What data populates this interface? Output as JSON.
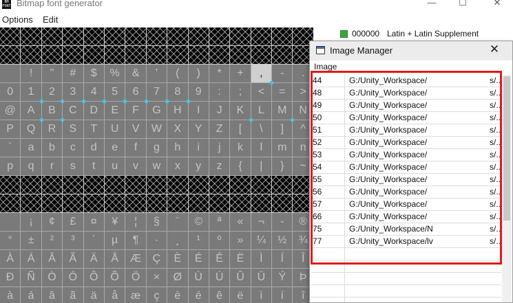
{
  "window": {
    "title": "Bitmap font generator",
    "icon_text": "BM FONT",
    "controls": {
      "minimize": "—",
      "maximize": "☐",
      "close": "✕"
    }
  },
  "menu": {
    "options": "Options",
    "edit": "Edit"
  },
  "grid": {
    "rows": [
      {
        "style": "black",
        "cells": [
          "",
          "",
          "",
          "",
          "",
          "",
          "",
          "",
          "",
          "",
          "",
          "",
          "",
          "",
          ""
        ]
      },
      {
        "style": "black",
        "cells": [
          "",
          "",
          "",
          "",
          "",
          "",
          "",
          "",
          "",
          "",
          "",
          "",
          "",
          "",
          ""
        ]
      },
      {
        "style": "gray",
        "cells": [
          " ",
          "!",
          "\"",
          "#",
          "$",
          "%",
          "&",
          "'",
          "(",
          ")",
          "*",
          "+",
          ",",
          "-",
          "."
        ]
      },
      {
        "style": "gray",
        "cells": [
          "0",
          "1",
          "2",
          "3",
          "4",
          "5",
          "6",
          "7",
          "8",
          "9",
          ":",
          ";",
          "<",
          "=",
          ">"
        ]
      },
      {
        "style": "gray",
        "cells": [
          "@",
          "A",
          "B",
          "C",
          "D",
          "E",
          "F",
          "G",
          "H",
          "I",
          "J",
          "K",
          "L",
          "M",
          "N"
        ]
      },
      {
        "style": "gray",
        "cells": [
          "P",
          "Q",
          "R",
          "S",
          "T",
          "U",
          "V",
          "W",
          "X",
          "Y",
          "Z",
          "[",
          "\\",
          "]",
          "^"
        ]
      },
      {
        "style": "gray",
        "cells": [
          "`",
          "a",
          "b",
          "c",
          "d",
          "e",
          "f",
          "g",
          "h",
          "i",
          "j",
          "k",
          "l",
          "m",
          "n"
        ]
      },
      {
        "style": "gray",
        "cells": [
          "p",
          "q",
          "r",
          "s",
          "t",
          "u",
          "v",
          "w",
          "x",
          "y",
          "z",
          "{",
          "|",
          "}",
          "~"
        ]
      },
      {
        "style": "black",
        "cells": [
          "",
          "",
          "",
          "",
          "",
          "",
          "",
          "",
          "",
          "",
          "",
          "",
          "",
          "",
          ""
        ]
      },
      {
        "style": "black",
        "cells": [
          "",
          "",
          "",
          "",
          "",
          "",
          "",
          "",
          "",
          "",
          "",
          "",
          "",
          "",
          ""
        ]
      },
      {
        "style": "gray",
        "cells": [
          " ",
          "¡",
          "¢",
          "£",
          "¤",
          "¥",
          "¦",
          "§",
          "¨",
          "©",
          "ª",
          "«",
          "¬",
          "-",
          "®"
        ]
      },
      {
        "style": "gray",
        "cells": [
          "°",
          "±",
          "²",
          "³",
          "´",
          "µ",
          "¶",
          "·",
          "¸",
          "¹",
          "º",
          "»",
          "¼",
          "½",
          "¾"
        ]
      },
      {
        "style": "gray",
        "cells": [
          "À",
          "Á",
          "Â",
          "Ã",
          "Ä",
          "Å",
          "Æ",
          "Ç",
          "È",
          "É",
          "Ê",
          "Ë",
          "Ì",
          "Í",
          "Î"
        ]
      },
      {
        "style": "gray",
        "cells": [
          "Ð",
          "Ñ",
          "Ò",
          "Ó",
          "Ô",
          "Õ",
          "Ö",
          "×",
          "Ø",
          "Ù",
          "Ú",
          "Û",
          "Ü",
          "Ý",
          "Þ"
        ]
      },
      {
        "style": "gray",
        "cells": [
          "à",
          "á",
          "â",
          "ã",
          "ä",
          "å",
          "æ",
          "ç",
          "è",
          "é",
          "ê",
          "ë",
          "ì",
          "í",
          "î"
        ]
      }
    ],
    "highlighted_cell": [
      2,
      12
    ],
    "marked_cells": [
      [
        2,
        12
      ],
      [
        3,
        1
      ],
      [
        3,
        2
      ],
      [
        3,
        3
      ],
      [
        3,
        4
      ],
      [
        3,
        5
      ],
      [
        3,
        6
      ],
      [
        3,
        7
      ],
      [
        3,
        8
      ],
      [
        4,
        1
      ],
      [
        4,
        2
      ],
      [
        4,
        11
      ],
      [
        4,
        13
      ]
    ]
  },
  "charset": {
    "code": "000000",
    "name": "Latin + Latin Supplement"
  },
  "image_manager": {
    "title": "Image Manager",
    "close_label": "✕",
    "column_header": "Image",
    "rows": [
      {
        "id": "44",
        "path": "G:/Unity_Workspace/",
        "tail": "s/.."
      },
      {
        "id": "48",
        "path": "G:/Unity_Workspace/",
        "tail": "s/.."
      },
      {
        "id": "49",
        "path": "G:/Unity_Workspace/",
        "tail": "s/.."
      },
      {
        "id": "50",
        "path": "G:/Unity_Workspace/",
        "tail": "s/.."
      },
      {
        "id": "51",
        "path": "G:/Unity_Workspace/",
        "tail": "s/.."
      },
      {
        "id": "52",
        "path": "G:/Unity_Workspace/",
        "tail": "s/.."
      },
      {
        "id": "53",
        "path": "G:/Unity_Workspace/",
        "tail": "s/.."
      },
      {
        "id": "54",
        "path": "G:/Unity_Workspace/",
        "tail": "s/.."
      },
      {
        "id": "55",
        "path": "G:/Unity_Workspace/",
        "tail": "s/.."
      },
      {
        "id": "56",
        "path": "G:/Unity_Workspace/",
        "tail": "s/.."
      },
      {
        "id": "57",
        "path": "G:/Unity_Workspace/",
        "tail": "s/.."
      },
      {
        "id": "66",
        "path": "G:/Unity_Workspace/",
        "tail": "s/.."
      },
      {
        "id": "75",
        "path": "G:/Unity_Workspace/N",
        "tail": "s/.."
      },
      {
        "id": "77",
        "path": "G:/Unity_Workspace/lv",
        "tail": "s/.."
      }
    ],
    "empty_rows": 4
  },
  "colors": {
    "highlight_border": "#e01b1b",
    "marker": "#33c4e6",
    "grid_gray": "#7a7a7a"
  }
}
